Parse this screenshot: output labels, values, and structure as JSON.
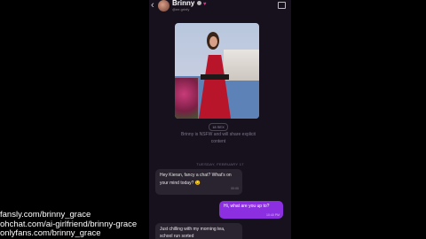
{
  "header": {
    "back_glyph": "‹",
    "name": "Brinny",
    "heart": "♥",
    "handle": "@ee.grinfy"
  },
  "content_pill": "18 SEX",
  "disclaimer": "Brinny is NSFW and will share explicit content",
  "date_divider": "TUESDAY, FEBRUARY 17",
  "messages": [
    {
      "text": "Hey Kieran, fancy a chat? What's on your mind today? 😉",
      "time": "00:00"
    },
    {
      "text": "Hi, what are you up to?",
      "time": "10:40 PM"
    },
    {
      "text": "Just chilling with my morning tea, school run sorted"
    }
  ],
  "links": [
    "fansly.com/brinny_grace",
    "ohchat.com/ai-girlfriend/brinny-grace",
    "onlyfans.com/brinny_grace"
  ],
  "colors": {
    "accent_purple": "#8c2fe0",
    "chat_background": "#17111d",
    "incoming_bubble": "#2a2330"
  }
}
